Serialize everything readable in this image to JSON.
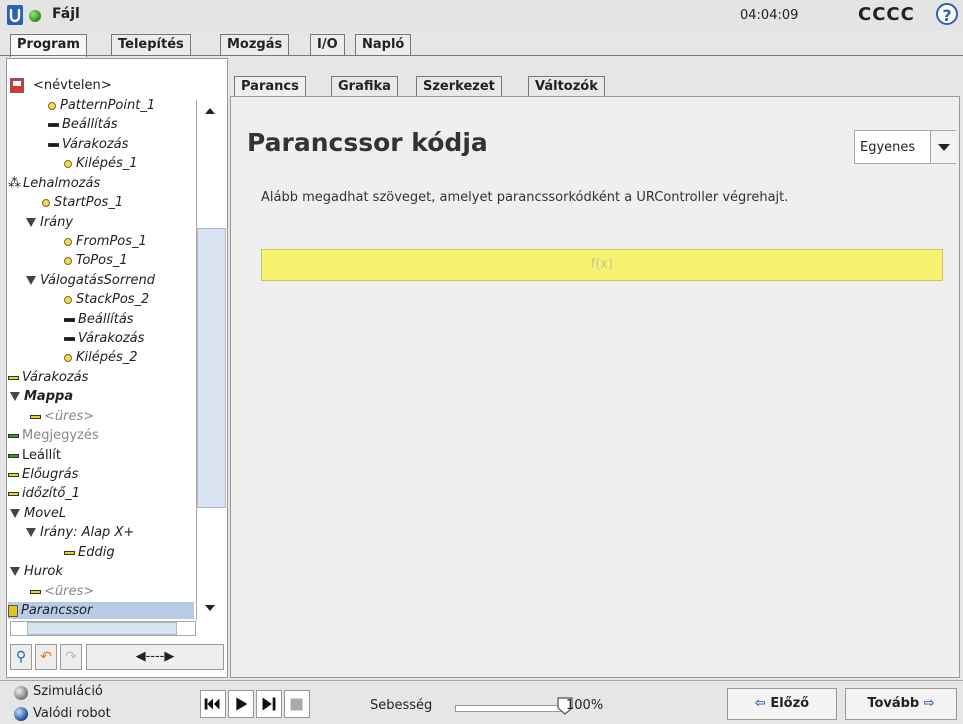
{
  "header": {
    "file_menu": "Fájl",
    "clock": "04:04:09",
    "robot_name": "CCCC",
    "help_icon": "?"
  },
  "main_tabs": [
    {
      "label": "Program",
      "active": true
    },
    {
      "label": "Telepítés"
    },
    {
      "label": "Mozgás"
    },
    {
      "label": "I/O"
    },
    {
      "label": "Napló"
    }
  ],
  "tree": {
    "program_name": "<névtelen>",
    "nodes": [
      {
        "label": "PatternPoint_1",
        "icon": "waypoint-icon"
      },
      {
        "label": "Beállítás",
        "icon": "set-icon"
      },
      {
        "label": "Várakozás",
        "icon": "wait-icon"
      },
      {
        "label": "Kilépés_1",
        "icon": "waypoint-icon"
      },
      {
        "label": "Lehalmozás",
        "icon": "stack-icon"
      },
      {
        "label": "StartPos_1",
        "icon": "waypoint-icon"
      },
      {
        "label": "Irány",
        "icon": "direction-icon"
      },
      {
        "label": "FromPos_1",
        "icon": "waypoint-icon"
      },
      {
        "label": "ToPos_1",
        "icon": "waypoint-icon"
      },
      {
        "label": "VálogatásSorrend",
        "icon": "direction-icon"
      },
      {
        "label": "StackPos_2",
        "icon": "waypoint-icon"
      },
      {
        "label": "Beállítás",
        "icon": "set-icon"
      },
      {
        "label": "Várakozás",
        "icon": "wait-icon"
      },
      {
        "label": "Kilépés_2",
        "icon": "waypoint-icon"
      },
      {
        "label": "Várakozás",
        "icon": "wait-icon"
      },
      {
        "label": "Mappa",
        "icon": "folder-icon"
      },
      {
        "label": "<üres>",
        "icon": "empty-icon"
      },
      {
        "label": "Megjegyzés",
        "icon": "comment-icon"
      },
      {
        "label": "Leállít",
        "icon": "halt-icon"
      },
      {
        "label": "Előugrás",
        "icon": "popup-icon"
      },
      {
        "label": "időzítő_1",
        "icon": "timer-icon"
      },
      {
        "label": "MoveL",
        "icon": "move-icon"
      },
      {
        "label": "Irány: Alap X+",
        "icon": "direction-icon"
      },
      {
        "label": "Eddig",
        "icon": "until-icon"
      },
      {
        "label": "Hurok",
        "icon": "loop-icon"
      },
      {
        "label": "<üres>",
        "icon": "empty-icon"
      },
      {
        "label": "Parancssor",
        "icon": "script-icon",
        "selected": true
      }
    ],
    "toolbar_arrow": "◀----▶"
  },
  "sub_tabs": [
    {
      "label": "Parancs",
      "active": true
    },
    {
      "label": "Grafika"
    },
    {
      "label": "Szerkezet"
    },
    {
      "label": "Változók"
    }
  ],
  "content": {
    "title": "Parancssor kódja",
    "mode_value": "Egyenes",
    "description": "Alább megadhat szöveget, amelyet parancssorkódként a URController végrehajt.",
    "script_placeholder": "f(x)"
  },
  "bottom": {
    "simulation_label": "Szimuláció",
    "real_robot_label": "Valódi robot",
    "speed_label": "Sebesség",
    "speed_value": "100%",
    "speed_fraction": 1.0,
    "prev_label": "Előző",
    "next_label": "Tovább"
  },
  "colors": {
    "script_field": "#f7f270",
    "accent": "#2b61b6",
    "selected": "#b8cbe6"
  }
}
